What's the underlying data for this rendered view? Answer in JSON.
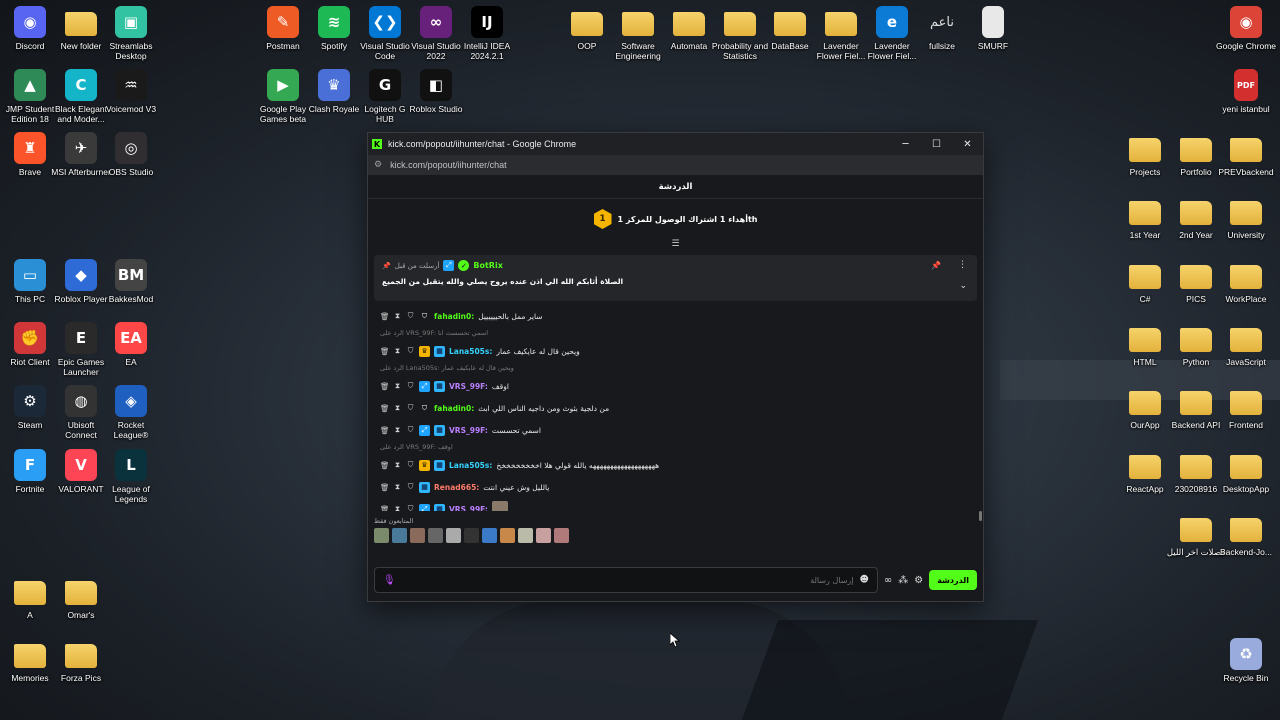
{
  "desktop": {
    "icons": [
      {
        "label": "Discord",
        "icon": "discord-icon",
        "color": "#5865f2",
        "glyph": "◉"
      },
      {
        "label": "New folder",
        "icon": "folder-icon",
        "color": "folder",
        "glyph": ""
      },
      {
        "label": "Streamlabs Desktop",
        "icon": "streamlabs-icon",
        "color": "#31c3a2",
        "glyph": "▣"
      },
      {
        "label": "JMP Student Edition 18",
        "icon": "jmp-icon",
        "color": "#2e8b57",
        "glyph": "▲"
      },
      {
        "label": "Black Elegant and Moder...",
        "icon": "canva-icon",
        "color": "#15b5c9",
        "glyph": "C"
      },
      {
        "label": "Voicemod V3",
        "icon": "voicemod-icon",
        "color": "#1a1a1a",
        "glyph": "♒"
      },
      {
        "label": "Brave",
        "icon": "brave-icon",
        "color": "#fb542b",
        "glyph": "♜"
      },
      {
        "label": "MSI Afterburner",
        "icon": "msi-icon",
        "color": "#3a3a3a",
        "glyph": "✈"
      },
      {
        "label": "OBS Studio",
        "icon": "obs-icon",
        "color": "#302e31",
        "glyph": "◎"
      },
      {
        "label": "This PC",
        "icon": "pc-icon",
        "color": "#2b8fd6",
        "glyph": "▭"
      },
      {
        "label": "Roblox Player",
        "icon": "roblox-icon",
        "color": "#2f6bd6",
        "glyph": "◆"
      },
      {
        "label": "BakkesMod",
        "icon": "bakkesmod-icon",
        "color": "#444",
        "glyph": "BM"
      },
      {
        "label": "Riot Client",
        "icon": "riot-icon",
        "color": "#d13639",
        "glyph": "✊"
      },
      {
        "label": "Epic Games Launcher",
        "icon": "epic-icon",
        "color": "#2a2a2a",
        "glyph": "E"
      },
      {
        "label": "EA",
        "icon": "ea-icon",
        "color": "#ff4747",
        "glyph": "EA"
      },
      {
        "label": "Steam",
        "icon": "steam-icon",
        "color": "#1b2838",
        "glyph": "⚙"
      },
      {
        "label": "Ubisoft Connect",
        "icon": "ubisoft-icon",
        "color": "#333",
        "glyph": "◍"
      },
      {
        "label": "Rocket League®",
        "icon": "rocketleague-icon",
        "color": "#1f5fbf",
        "glyph": "◈"
      },
      {
        "label": "Fortnite",
        "icon": "fortnite-icon",
        "color": "#2a9df4",
        "glyph": "F"
      },
      {
        "label": "VALORANT",
        "icon": "valorant-icon",
        "color": "#fd4556",
        "glyph": "V"
      },
      {
        "label": "League of Legends",
        "icon": "lol-icon",
        "color": "#0a323c",
        "glyph": "L"
      },
      {
        "label": "A",
        "icon": "folder-icon",
        "color": "folder",
        "glyph": ""
      },
      {
        "label": "Omar's",
        "icon": "folder-icon",
        "color": "folder",
        "glyph": ""
      },
      {
        "label": "Memories",
        "icon": "folder-icon",
        "color": "folder",
        "glyph": ""
      },
      {
        "label": "Forza Pics",
        "icon": "folder-icon",
        "color": "folder",
        "glyph": ""
      },
      {
        "label": "Postman",
        "icon": "postman-icon",
        "color": "#ef5b25",
        "glyph": "✎"
      },
      {
        "label": "Spotify",
        "icon": "spotify-icon",
        "color": "#1db954",
        "glyph": "≋"
      },
      {
        "label": "Visual Studio Code",
        "icon": "vscode-icon",
        "color": "#0078d4",
        "glyph": "❮❯"
      },
      {
        "label": "Visual Studio 2022",
        "icon": "visualstudio-icon",
        "color": "#68217a",
        "glyph": "∞"
      },
      {
        "label": "IntelliJ IDEA 2024.2.1",
        "icon": "intellij-icon",
        "color": "#000",
        "glyph": "IJ"
      },
      {
        "label": "Google Play Games beta",
        "icon": "playgames-icon",
        "color": "#34a853",
        "glyph": "▶"
      },
      {
        "label": "Clash Royale",
        "icon": "clashroyale-icon",
        "color": "#4a6fd6",
        "glyph": "♛"
      },
      {
        "label": "Logitech G HUB",
        "icon": "ghub-icon",
        "color": "#111",
        "glyph": "G"
      },
      {
        "label": "Roblox Studio",
        "icon": "robloxstudio-icon",
        "color": "#111",
        "glyph": "◧"
      },
      {
        "label": "OOP",
        "icon": "folder-icon",
        "color": "folder",
        "glyph": ""
      },
      {
        "label": "Software Engineering",
        "icon": "folder-icon",
        "color": "folder",
        "glyph": ""
      },
      {
        "label": "Automata",
        "icon": "folder-icon",
        "color": "folder",
        "glyph": ""
      },
      {
        "label": "Probability and Statistics",
        "icon": "folder-icon",
        "color": "folder",
        "glyph": ""
      },
      {
        "label": "DataBase",
        "icon": "folder-icon",
        "color": "folder",
        "glyph": ""
      },
      {
        "label": "Lavender Flower Fiel...",
        "icon": "folder-icon",
        "color": "folder",
        "glyph": ""
      },
      {
        "label": "Lavender Flower Fiel...",
        "icon": "edge-icon",
        "color": "#0c7bd6",
        "glyph": "e"
      },
      {
        "label": "fullsize",
        "icon": "arabic-text-icon",
        "color": "transparent",
        "glyph": "ناعم"
      },
      {
        "label": "SMURF",
        "icon": "document-icon",
        "color": "#e8e8e8",
        "glyph": ""
      },
      {
        "label": "Google Chrome",
        "icon": "chrome-icon",
        "color": "#db4437",
        "glyph": "◉"
      },
      {
        "label": "yeni istanbul",
        "icon": "pdf-icon",
        "color": "#d32f2f",
        "glyph": "PDF"
      },
      {
        "label": "Projects",
        "icon": "folder-icon",
        "color": "folder",
        "glyph": ""
      },
      {
        "label": "Portfolio",
        "icon": "folder-icon",
        "color": "folder",
        "glyph": ""
      },
      {
        "label": "PREVbackend",
        "icon": "folder-icon",
        "color": "folder",
        "glyph": ""
      },
      {
        "label": "1st Year",
        "icon": "folder-icon",
        "color": "folder",
        "glyph": ""
      },
      {
        "label": "2nd Year",
        "icon": "folder-icon",
        "color": "folder",
        "glyph": ""
      },
      {
        "label": "University",
        "icon": "folder-icon",
        "color": "folder",
        "glyph": ""
      },
      {
        "label": "C#",
        "icon": "folder-icon",
        "color": "folder",
        "glyph": ""
      },
      {
        "label": "PICS",
        "icon": "folder-icon",
        "color": "folder",
        "glyph": ""
      },
      {
        "label": "WorkPlace",
        "icon": "folder-icon",
        "color": "folder",
        "glyph": ""
      },
      {
        "label": "HTML",
        "icon": "folder-icon",
        "color": "folder",
        "glyph": ""
      },
      {
        "label": "Python",
        "icon": "folder-icon",
        "color": "folder",
        "glyph": ""
      },
      {
        "label": "JavaScript",
        "icon": "folder-icon",
        "color": "folder",
        "glyph": ""
      },
      {
        "label": "OurApp",
        "icon": "folder-icon",
        "color": "folder",
        "glyph": ""
      },
      {
        "label": "Backend API",
        "icon": "folder-icon",
        "color": "folder",
        "glyph": ""
      },
      {
        "label": "Frontend",
        "icon": "folder-icon",
        "color": "folder",
        "glyph": ""
      },
      {
        "label": "ReactApp",
        "icon": "folder-icon",
        "color": "folder",
        "glyph": ""
      },
      {
        "label": "230208916",
        "icon": "folder-icon",
        "color": "folder",
        "glyph": ""
      },
      {
        "label": "DesktopApp",
        "icon": "folder-icon",
        "color": "folder",
        "glyph": ""
      },
      {
        "label": "فصلات اخر الليل",
        "icon": "folder-icon",
        "color": "folder",
        "glyph": ""
      },
      {
        "label": "Backend-Jo...",
        "icon": "folder-icon",
        "color": "folder",
        "glyph": ""
      },
      {
        "label": "Recycle Bin",
        "icon": "recycle-bin-icon",
        "color": "#9ad",
        "glyph": "♻"
      }
    ]
  },
  "window": {
    "title": "kick.com/popout/iihunter/chat - Google Chrome",
    "url": "kick.com/popout/iihunter/chat",
    "minimize": "─",
    "maximize": "☐",
    "close": "✕"
  },
  "chat": {
    "header": "الدردشة",
    "gift_banner": "أهداء 1 اشتراك الوصول للمركز 1th",
    "gift_rank": "1",
    "pinned": {
      "pinned_by": "أرسلت من قبل",
      "author": "BotRix",
      "message": "الصلاة أثابكم الله الي اذن عنده يروح يصلي والله يتقبل من الجميع"
    },
    "messages": [
      {
        "reply_to": "",
        "user": "fahadin0:",
        "user_color": "#53fc18",
        "badges": [
          "mod"
        ],
        "text": "ساير ممل بالحييييييل"
      },
      {
        "reply_to": "الرد على VRS_99F: اسمي تحسست انا",
        "user": "Lana505s:",
        "user_color": "#34d3ff",
        "badges": [
          "crown",
          "sub"
        ],
        "text": "ويحين قال له عايكيف عمار"
      },
      {
        "reply_to": "الرد على Lana505s: ويحين قال له عايكيف عمار",
        "user": "VRS_99F:",
        "user_color": "#b980ff",
        "badges": [
          "verified",
          "sub"
        ],
        "text": "اوقف"
      },
      {
        "reply_to": "",
        "user": "fahadin0:",
        "user_color": "#53fc18",
        "badges": [
          "mod"
        ],
        "text": "من دلجية بثوث ومن داجيه الناس اللي ابث"
      },
      {
        "reply_to": "",
        "user": "VRS_99F:",
        "user_color": "#b980ff",
        "badges": [
          "verified",
          "sub"
        ],
        "text": "اسمي تحسست"
      },
      {
        "reply_to": "الرد على VRS_99F: اوقف",
        "user": "Lana505s:",
        "user_color": "#34d3ff",
        "badges": [
          "crown",
          "sub"
        ],
        "text": "هههههههههههههههههههه يالله قولي هلا اخخخخخخخخخ"
      },
      {
        "reply_to": "",
        "user": "Renad665:",
        "user_color": "#ff7a6a",
        "badges": [
          "sub"
        ],
        "text": "يالليل وش عيني انتت"
      },
      {
        "reply_to": "",
        "user": "VRS_99F:",
        "user_color": "#b980ff",
        "badges": [
          "verified",
          "sub"
        ],
        "text": ""
      }
    ],
    "viewers_label": "المتابعون فقط",
    "viewer_avatars": [
      "#7a8a6a",
      "#4a7a9a",
      "#8a6a5a",
      "#666",
      "#aaa",
      "#333",
      "#3a7ac8",
      "#c8884a",
      "#bba",
      "#c8a0a0",
      "#b07a7a"
    ],
    "input_placeholder": "إرسال رسالة",
    "send_label": "الدردشة"
  }
}
